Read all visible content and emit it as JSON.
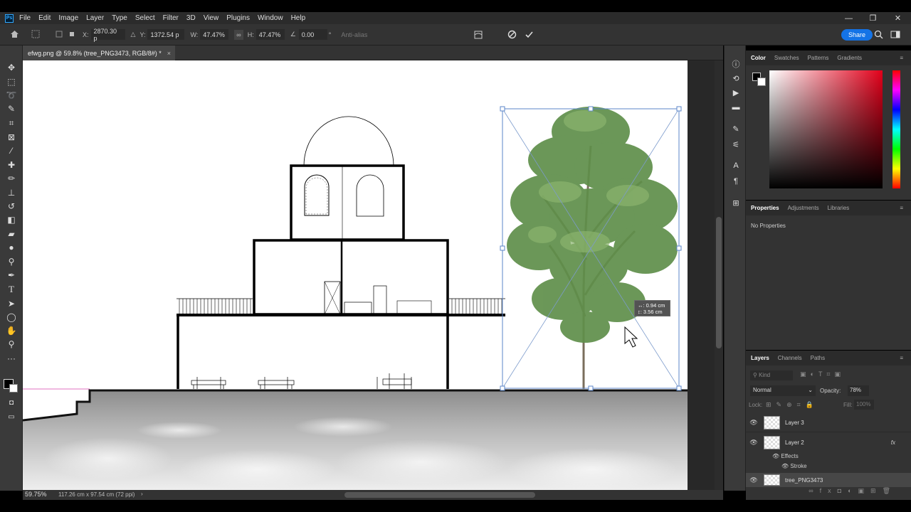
{
  "app": {
    "badge": "Ps"
  },
  "menu": [
    "File",
    "Edit",
    "Image",
    "Layer",
    "Type",
    "Select",
    "Filter",
    "3D",
    "View",
    "Plugins",
    "Window",
    "Help"
  ],
  "window_controls": {
    "minimize": "—",
    "restore": "❐",
    "close": "✕"
  },
  "options": {
    "x_label": "X:",
    "x_value": "2870.30 p",
    "y_label": "Y:",
    "y_value": "1372.54 p",
    "w_label": "W:",
    "w_value": "47.47%",
    "h_label": "H:",
    "h_value": "47.47%",
    "angle_value": "0.00",
    "angle_unit": "°",
    "antialias": "Anti-alias",
    "share": "Share"
  },
  "document": {
    "tab_title": "efwg.png @ 59.8% (tree_PNG3473, RGB/8#) *",
    "close": "×",
    "transform_tooltip_line1": "↔: 0.94 cm",
    "transform_tooltip_line2": "↕: 3.56 cm"
  },
  "status": {
    "zoom": "59.75%",
    "doc_size": "117.26 cm x 97.54 cm (72 ppi)",
    "arrow": "›"
  },
  "color_panel": {
    "tabs": [
      "Color",
      "Swatches",
      "Patterns",
      "Gradients"
    ],
    "active": "Color",
    "foreground": "#000000",
    "background": "#ffffff"
  },
  "properties_panel": {
    "tabs": [
      "Properties",
      "Adjustments",
      "Libraries"
    ],
    "active": "Properties",
    "body": "No Properties"
  },
  "layers_panel": {
    "tabs": [
      "Layers",
      "Channels",
      "Paths"
    ],
    "active": "Layers",
    "kind_placeholder": "Kind",
    "blend_mode": "Normal",
    "opacity_label": "Opacity:",
    "opacity_value": "78%",
    "lock_label": "Lock:",
    "fill_label": "Fill:",
    "fill_value": "100%",
    "layers": [
      {
        "name": "Layer 3"
      },
      {
        "name": "Layer 2",
        "fx": "fx",
        "effects_label": "Effects",
        "effect": "Stroke"
      },
      {
        "name": "tree_PNG3473"
      }
    ]
  }
}
